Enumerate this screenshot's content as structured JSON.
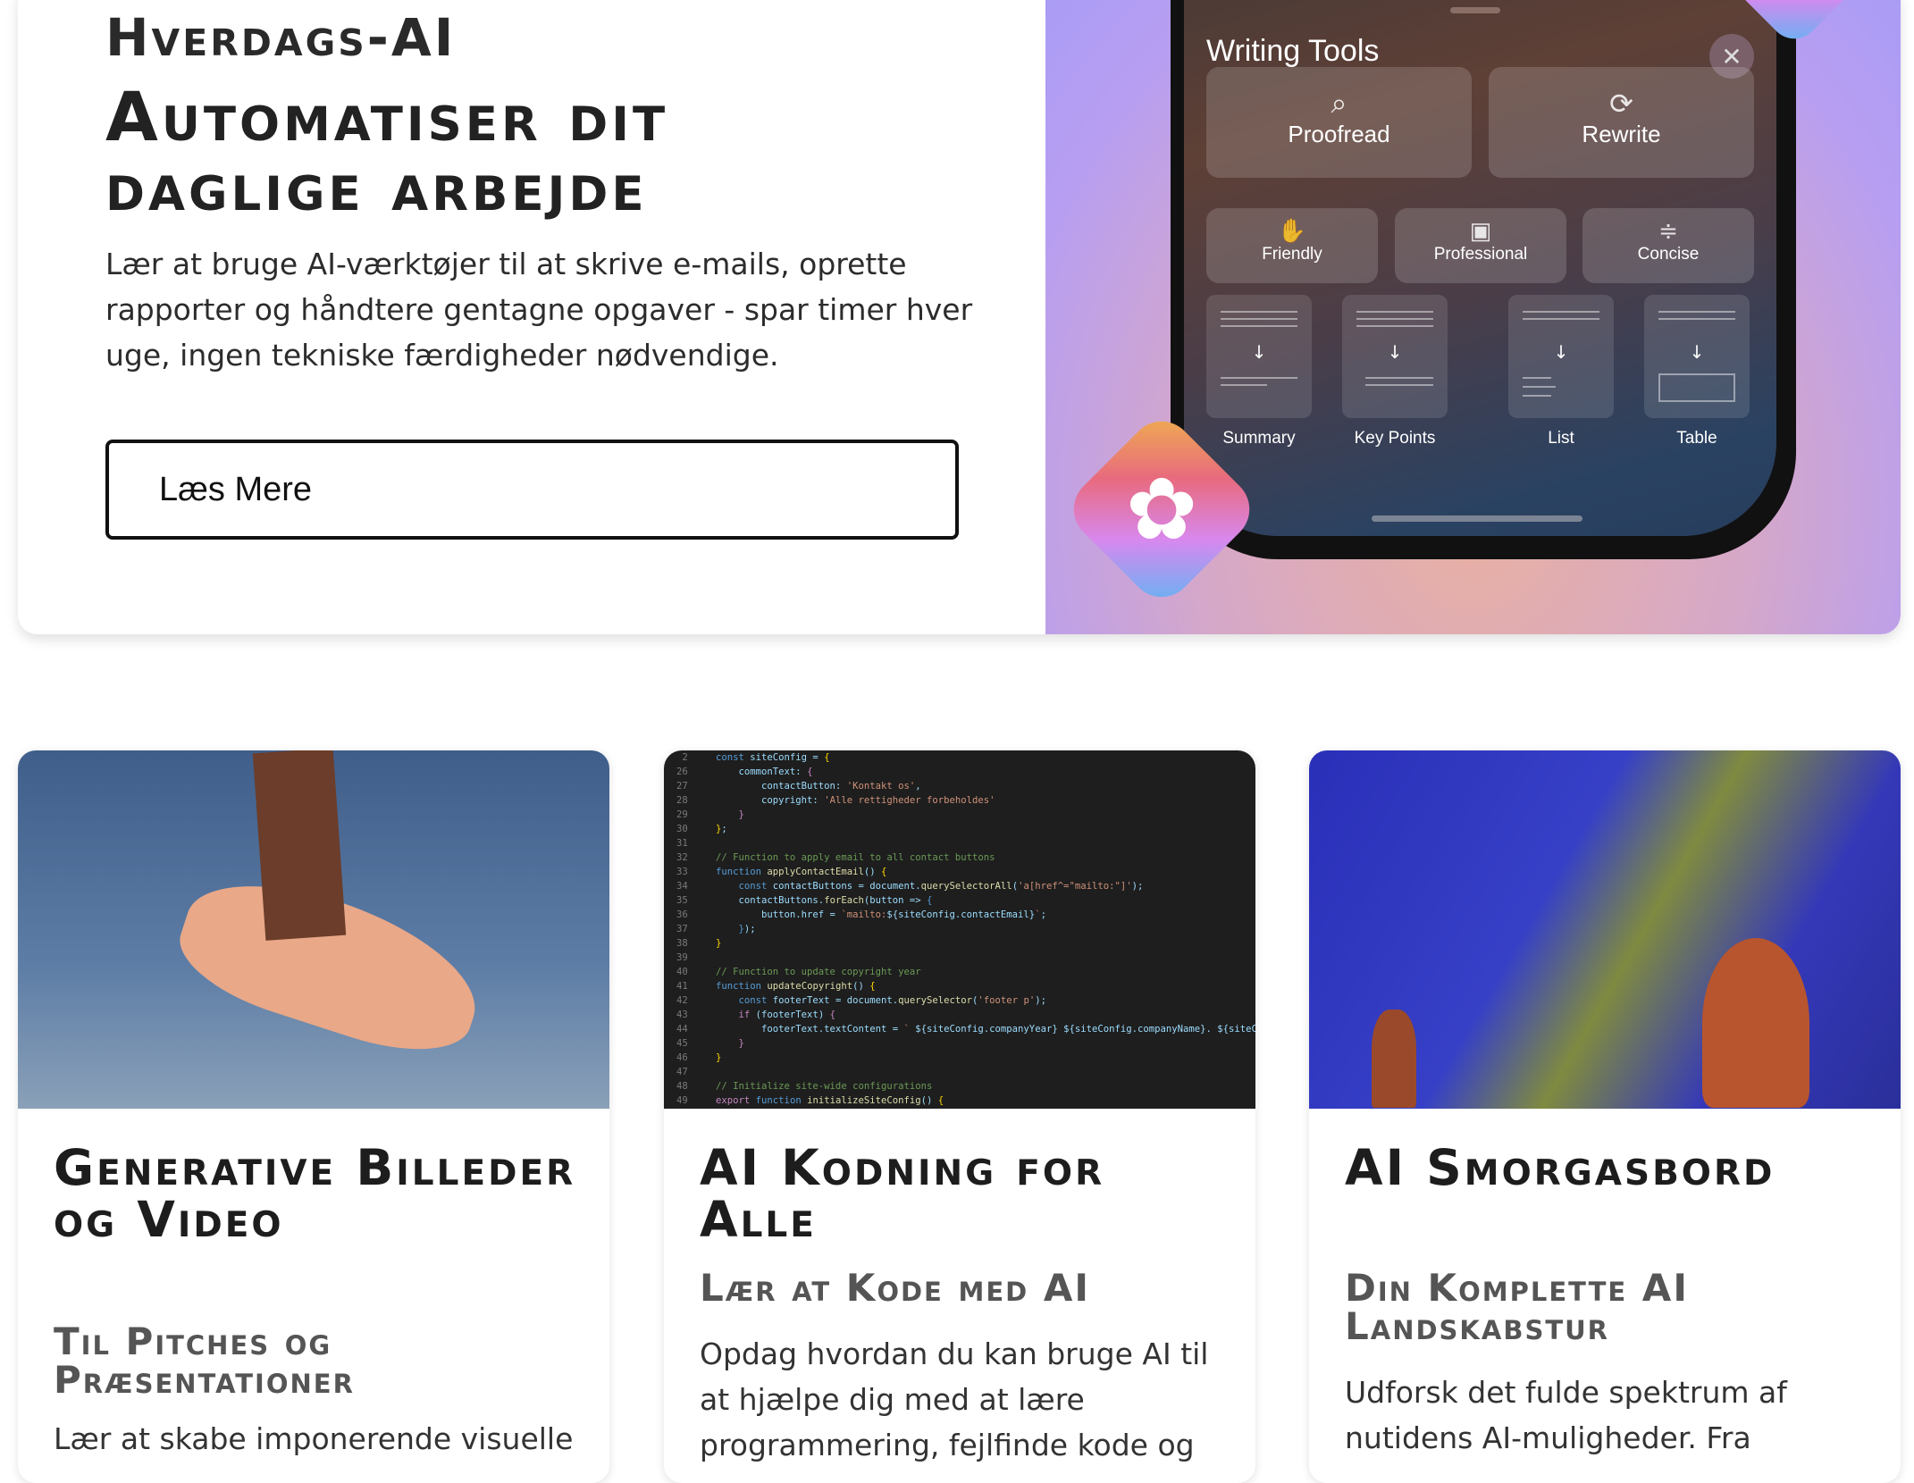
{
  "hero": {
    "eyebrow": "Hverdags-AI",
    "title_line1": "Automatiser dit",
    "title_line2": "daglige arbejde",
    "lead": "Lær at bruge AI-værktøjer til at skrive e-mails, oprette rapporter og håndtere gentagne opgaver - spar timer hver uge, ingen tekniske færdigheder nødvendige.",
    "button_label": "Læs Mere",
    "image": {
      "panel_title": "Writing Tools",
      "close": "✕",
      "big_tiles": [
        {
          "label": "Proofread",
          "icon": "magnifier-icon"
        },
        {
          "label": "Rewrite",
          "icon": "rewrite-icon"
        }
      ],
      "tone_tiles": [
        {
          "label": "Friendly",
          "icon": "hand-wave-icon"
        },
        {
          "label": "Professional",
          "icon": "briefcase-icon"
        },
        {
          "label": "Concise",
          "icon": "compress-icon"
        }
      ],
      "format_tiles": [
        "Summary",
        "Key Points",
        "List",
        "Table"
      ]
    }
  },
  "cards": [
    {
      "title": "Generative Billeder og Video",
      "subtitle": "Til Pitches og Præsentationer",
      "body": "Lær at skabe imponerende visuelle"
    },
    {
      "title": "AI Kodning for Alle",
      "subtitle": "Lær at Kode med AI",
      "body": "Opdag hvordan du kan bruge AI til at hjælpe dig med at lære programmering, fejlfinde kode og"
    },
    {
      "title": "AI Smorgasbord",
      "subtitle": "Din Komplette AI Landskabstur",
      "body": "Udforsk det fulde spektrum af nutidens AI-muligheder. Fra"
    }
  ]
}
